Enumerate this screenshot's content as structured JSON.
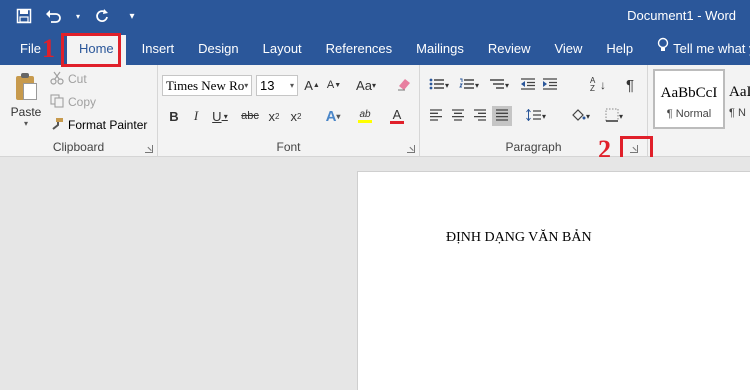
{
  "window": {
    "title": "Document1 - Word"
  },
  "tabs": [
    "File",
    "Home",
    "Insert",
    "Design",
    "Layout",
    "References",
    "Mailings",
    "Review",
    "View",
    "Help"
  ],
  "tell_me": "Tell me what you",
  "clipboard": {
    "paste": "Paste",
    "cut": "Cut",
    "copy": "Copy",
    "format_painter": "Format Painter",
    "label": "Clipboard"
  },
  "font": {
    "name": "Times New Ro",
    "size": "13",
    "grow": "A",
    "shrink": "A",
    "change_case": "Aa",
    "bold": "B",
    "italic": "I",
    "underline": "U",
    "strike": "abc",
    "subscript": "x",
    "superscript": "x",
    "subscript_mark": "2",
    "superscript_mark": "2",
    "text_effects": "A",
    "highlight": "ab",
    "font_color": "A",
    "label": "Font"
  },
  "paragraph": {
    "label": "Paragraph",
    "sort": "A Z",
    "pilcrow": "¶"
  },
  "styles": [
    {
      "sample": "AaBbCcI",
      "name": "¶ Normal"
    },
    {
      "sample": "AaI",
      "name": "¶ N"
    }
  ],
  "annotations": {
    "one": "1",
    "two": "2"
  },
  "document": {
    "text": "ĐỊNH DẠNG VĂN BẢN"
  },
  "colors": {
    "accent": "#2b579a",
    "annotation": "#e0202a",
    "font_color_bar": "#e0202a",
    "highlight_bar": "#ffff00"
  }
}
